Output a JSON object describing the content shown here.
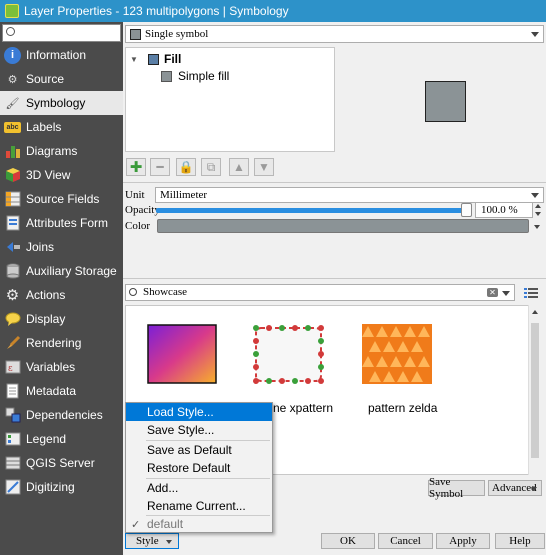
{
  "window": {
    "title": "Layer Properties - 123 multipolygons | Symbology"
  },
  "sidebar": {
    "search_placeholder": "",
    "items": [
      {
        "label": "Information",
        "icon": "info-icon"
      },
      {
        "label": "Source",
        "icon": "wrench-icon"
      },
      {
        "label": "Symbology",
        "icon": "paintbrush-icon"
      },
      {
        "label": "Labels",
        "icon": "abc-label-icon"
      },
      {
        "label": "Diagrams",
        "icon": "bar-chart-icon"
      },
      {
        "label": "3D View",
        "icon": "cube-icon"
      },
      {
        "label": "Source Fields",
        "icon": "fields-table-icon"
      },
      {
        "label": "Attributes Form",
        "icon": "form-icon"
      },
      {
        "label": "Joins",
        "icon": "join-icon"
      },
      {
        "label": "Auxiliary Storage",
        "icon": "database-icon"
      },
      {
        "label": "Actions",
        "icon": "gear-icon"
      },
      {
        "label": "Display",
        "icon": "speech-bubble-icon"
      },
      {
        "label": "Rendering",
        "icon": "brush-icon"
      },
      {
        "label": "Variables",
        "icon": "variables-icon"
      },
      {
        "label": "Metadata",
        "icon": "document-icon"
      },
      {
        "label": "Dependencies",
        "icon": "dependencies-icon"
      },
      {
        "label": "Legend",
        "icon": "legend-icon"
      },
      {
        "label": "QGIS Server",
        "icon": "server-icon"
      },
      {
        "label": "Digitizing",
        "icon": "digitizing-icon"
      }
    ],
    "active": "Symbology"
  },
  "renderer": {
    "value": "Single symbol"
  },
  "symbol_tree": {
    "root": "Fill",
    "child": "Simple fill"
  },
  "fill_color": "#8b9396",
  "props": {
    "unit_label": "Unit",
    "unit_value": "Millimeter",
    "opacity_label": "Opacity",
    "opacity_value": "100.0 %",
    "opacity_fraction": 1.0,
    "color_label": "Color"
  },
  "library": {
    "search_value": "Showcase",
    "styles": [
      {
        "label": ""
      },
      {
        "label": "ne xpattern"
      },
      {
        "label": "pattern zelda"
      }
    ]
  },
  "buttons": {
    "save_symbol": "Save Symbol",
    "advanced": "Advanced",
    "style": "Style",
    "ok": "OK",
    "cancel": "Cancel",
    "apply": "Apply",
    "help": "Help"
  },
  "style_menu": {
    "items": [
      "Load Style...",
      "Save Style...",
      "Save as Default",
      "Restore Default",
      "Add...",
      "Rename Current...",
      "default"
    ],
    "highlighted": "Load Style..."
  },
  "colors": {
    "accent": "#0078d7",
    "titlebar": "#2d92c9",
    "sidebar": "#4b4b4b"
  }
}
